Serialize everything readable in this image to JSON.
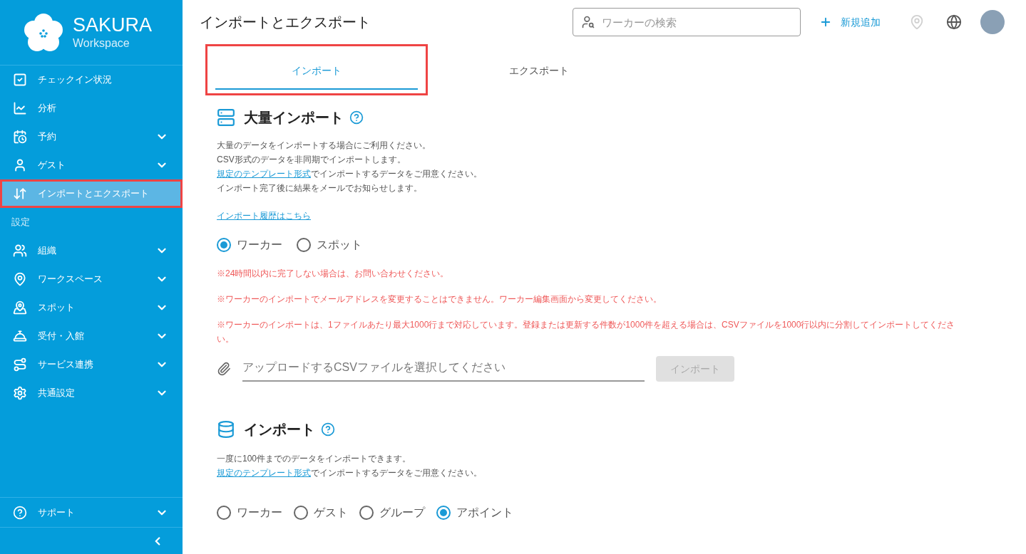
{
  "logo": {
    "name": "SAKURA",
    "sub": "Workspace"
  },
  "sidebar": {
    "items": [
      {
        "kind": "item",
        "label": "チェックイン状況",
        "expandable": false,
        "selected": false,
        "highlighted": false
      },
      {
        "kind": "item",
        "label": "分析",
        "expandable": false,
        "selected": false,
        "highlighted": false
      },
      {
        "kind": "item",
        "label": "予約",
        "expandable": true,
        "selected": false,
        "highlighted": false
      },
      {
        "kind": "item",
        "label": "ゲスト",
        "expandable": true,
        "selected": false,
        "highlighted": false
      },
      {
        "kind": "item",
        "label": "インポートとエクスポート",
        "expandable": false,
        "selected": true,
        "highlighted": true
      },
      {
        "kind": "section",
        "label": "設定"
      },
      {
        "kind": "item",
        "label": "組織",
        "expandable": true,
        "selected": false,
        "highlighted": false
      },
      {
        "kind": "item",
        "label": "ワークスペース",
        "expandable": true,
        "selected": false,
        "highlighted": false
      },
      {
        "kind": "item",
        "label": "スポット",
        "expandable": true,
        "selected": false,
        "highlighted": false
      },
      {
        "kind": "item",
        "label": "受付・入館",
        "expandable": true,
        "selected": false,
        "highlighted": false
      },
      {
        "kind": "item",
        "label": "サービス連携",
        "expandable": true,
        "selected": false,
        "highlighted": false
      },
      {
        "kind": "item",
        "label": "共通設定",
        "expandable": true,
        "selected": false,
        "highlighted": false
      }
    ],
    "support": {
      "label": "サポート",
      "expandable": true
    }
  },
  "header": {
    "title": "インポートとエクスポート",
    "search": {
      "placeholder": "ワーカーの検索"
    },
    "add_button": "新規追加"
  },
  "tabs": [
    {
      "label": "インポート",
      "selected": true,
      "highlighted": true
    },
    {
      "label": "エクスポート",
      "selected": false,
      "highlighted": false
    }
  ],
  "bulk_import": {
    "title": "大量インポート",
    "lines": [
      {
        "text": "大量のデータをインポートする場合にご利用ください。"
      },
      {
        "text": "CSV形式のデータを非同期でインポートします。"
      },
      {
        "link": "規定のテンプレート形式",
        "text": "でインポートするデータをご用意ください。"
      },
      {
        "text": "インポート完了後に結果をメールでお知らせします。"
      }
    ],
    "history_link": "インポート履歴はこちら",
    "options": [
      {
        "label": "ワーカー",
        "selected": true
      },
      {
        "label": "スポット",
        "selected": false
      }
    ],
    "notes": [
      "※24時間以内に完了しない場合は、お問い合わせください。",
      "※ワーカーのインポートでメールアドレスを変更することはできません。ワーカー編集画面から変更してください。",
      "※ワーカーのインポートは、1ファイルあたり最大1000行まで対応しています。登録または更新する件数が1000件を超える場合は、CSVファイルを1000行以内に分割してインポートしてください。"
    ],
    "file": {
      "placeholder": "アップロードするCSVファイルを選択してください"
    },
    "button": {
      "label": "インポート",
      "disabled": true
    }
  },
  "import": {
    "title": "インポート",
    "lines": [
      {
        "text": "一度に100件までのデータをインポートできます。"
      },
      {
        "link": "規定のテンプレート形式",
        "text": "でインポートするデータをご用意ください。"
      }
    ],
    "options": [
      {
        "label": "ワーカー",
        "selected": false
      },
      {
        "label": "ゲスト",
        "selected": false
      },
      {
        "label": "グループ",
        "selected": false
      },
      {
        "label": "アポイント",
        "selected": true
      }
    ]
  }
}
